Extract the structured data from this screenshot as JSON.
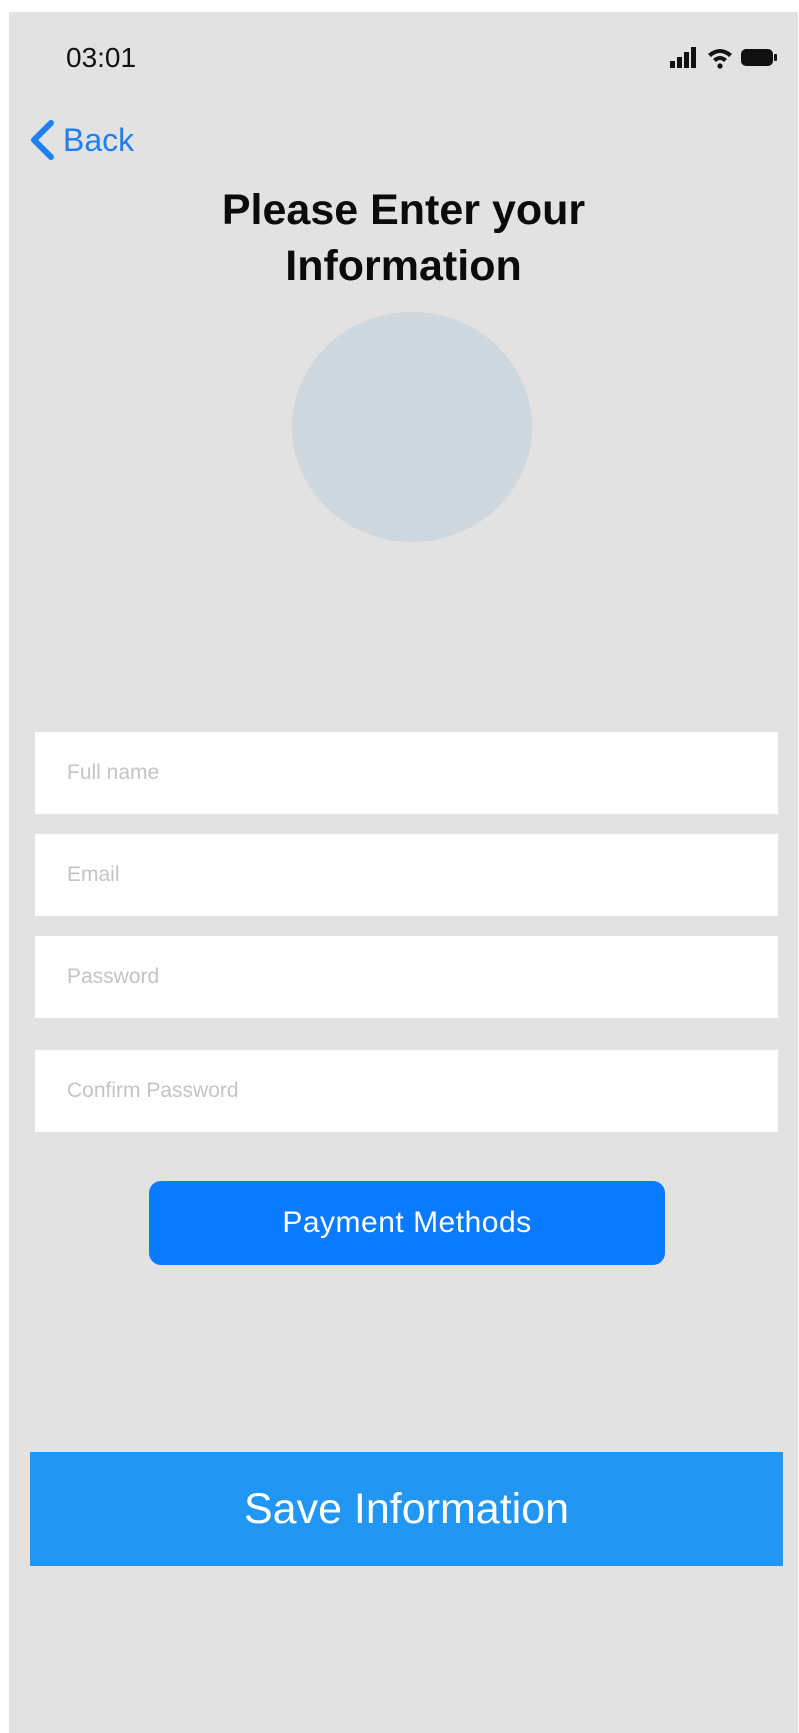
{
  "status_bar": {
    "time": "03:01",
    "icons": [
      "signal-icon",
      "wifi-icon",
      "battery-icon"
    ]
  },
  "navigation": {
    "back_label": "Back"
  },
  "header": {
    "title_line1": "Please Enter your",
    "title_line2": "Information"
  },
  "form": {
    "full_name": {
      "placeholder": "Full name",
      "value": ""
    },
    "email": {
      "placeholder": "Email",
      "value": ""
    },
    "password": {
      "placeholder": "Password",
      "value": ""
    },
    "confirm_password": {
      "placeholder": "Confirm Password",
      "value": ""
    }
  },
  "actions": {
    "payment_methods_label": "Payment Methods",
    "save_label": "Save Information"
  },
  "colors": {
    "background": "#e2e2e2",
    "accent_blue": "#0a7aff",
    "save_blue": "#2196f3",
    "back_blue": "#1e7ff0",
    "avatar_placeholder": "#cfd8de"
  }
}
